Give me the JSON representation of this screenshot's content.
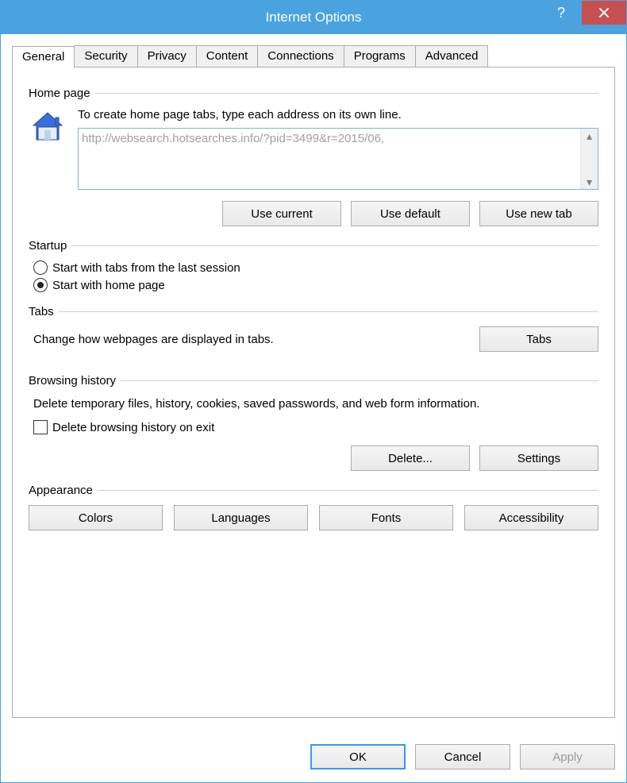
{
  "window": {
    "title": "Internet Options"
  },
  "tabs": [
    "General",
    "Security",
    "Privacy",
    "Content",
    "Connections",
    "Programs",
    "Advanced"
  ],
  "active_tab": 0,
  "homepage": {
    "group": "Home page",
    "hint": "To create home page tabs, type each address on its own line.",
    "url": "http://websearch.hotsearches.info/?pid=3499&r=2015/06,",
    "buttons": {
      "current": "Use current",
      "default": "Use default",
      "newtab": "Use new tab"
    }
  },
  "startup": {
    "group": "Startup",
    "opt_last": "Start with tabs from the last session",
    "opt_home": "Start with home page",
    "selected": "home"
  },
  "tabs_section": {
    "group": "Tabs",
    "desc": "Change how webpages are displayed in tabs.",
    "button": "Tabs"
  },
  "history": {
    "group": "Browsing history",
    "desc": "Delete temporary files, history, cookies, saved passwords, and web form information.",
    "chk_label": "Delete browsing history on exit",
    "delete": "Delete...",
    "settings": "Settings"
  },
  "appearance": {
    "group": "Appearance",
    "colors": "Colors",
    "languages": "Languages",
    "fonts": "Fonts",
    "accessibility": "Accessibility"
  },
  "footer": {
    "ok": "OK",
    "cancel": "Cancel",
    "apply": "Apply"
  }
}
